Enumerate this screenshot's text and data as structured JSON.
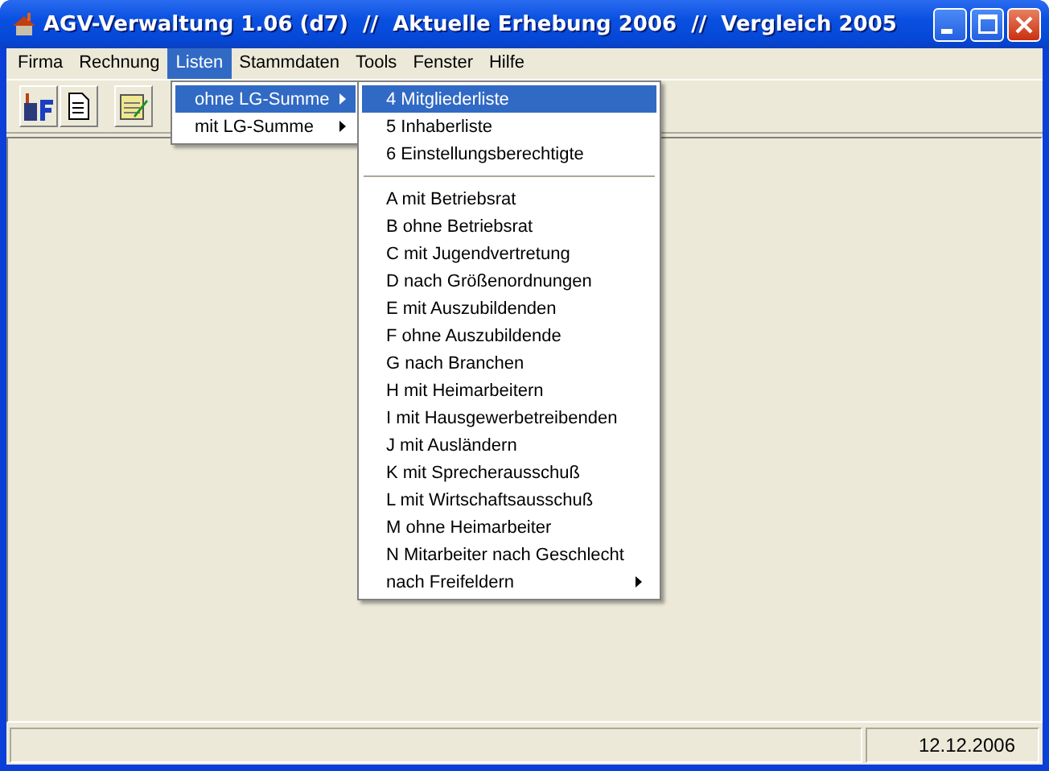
{
  "window": {
    "title": "AGV-Verwaltung 1.06 (d7)  //  Aktuelle Erhebung 2006  //  Vergleich 2005"
  },
  "menu_bar": [
    {
      "label": "Firma",
      "selected": false
    },
    {
      "label": "Rechnung",
      "selected": false
    },
    {
      "label": "Listen",
      "selected": true
    },
    {
      "label": "Stammdaten",
      "selected": false
    },
    {
      "label": "Tools",
      "selected": false
    },
    {
      "label": "Fenster",
      "selected": false
    },
    {
      "label": "Hilfe",
      "selected": false
    }
  ],
  "listen_menu": [
    {
      "label": "ohne LG-Summe",
      "selected": true,
      "has_submenu": true
    },
    {
      "label": "mit LG-Summe",
      "selected": false,
      "has_submenu": true
    }
  ],
  "submenu": [
    {
      "kind": "item",
      "label": "4 Mitgliederliste",
      "selected": true,
      "has_submenu": false
    },
    {
      "kind": "item",
      "label": "5 Inhaberliste",
      "selected": false,
      "has_submenu": false
    },
    {
      "kind": "item",
      "label": "6 Einstellungsberechtigte",
      "selected": false,
      "has_submenu": false
    },
    {
      "kind": "separator"
    },
    {
      "kind": "item",
      "label": "A mit Betriebsrat",
      "selected": false,
      "has_submenu": false
    },
    {
      "kind": "item",
      "label": "B ohne Betriebsrat",
      "selected": false,
      "has_submenu": false
    },
    {
      "kind": "item",
      "label": "C mit Jugendvertretung",
      "selected": false,
      "has_submenu": false
    },
    {
      "kind": "item",
      "label": "D nach Größenordnungen",
      "selected": false,
      "has_submenu": false
    },
    {
      "kind": "item",
      "label": "E mit Auszubildenden",
      "selected": false,
      "has_submenu": false
    },
    {
      "kind": "item",
      "label": "F ohne Auszubildende",
      "selected": false,
      "has_submenu": false
    },
    {
      "kind": "item",
      "label": "G nach Branchen",
      "selected": false,
      "has_submenu": false
    },
    {
      "kind": "item",
      "label": "H mit Heimarbeitern",
      "selected": false,
      "has_submenu": false
    },
    {
      "kind": "item",
      "label": "I mit Hausgewerbetreibenden",
      "selected": false,
      "has_submenu": false
    },
    {
      "kind": "item",
      "label": "J mit Ausländern",
      "selected": false,
      "has_submenu": false
    },
    {
      "kind": "item",
      "label": "K mit Sprecherausschuß",
      "selected": false,
      "has_submenu": false
    },
    {
      "kind": "item",
      "label": "L mit Wirtschaftsausschuß",
      "selected": false,
      "has_submenu": false
    },
    {
      "kind": "item",
      "label": "M ohne Heimarbeiter",
      "selected": false,
      "has_submenu": false
    },
    {
      "kind": "item",
      "label": "N Mitarbeiter nach Geschlecht",
      "selected": false,
      "has_submenu": false
    },
    {
      "kind": "item",
      "label": "nach Freifeldern",
      "selected": false,
      "has_submenu": true
    }
  ],
  "status_bar": {
    "date": "12.12.2006"
  }
}
